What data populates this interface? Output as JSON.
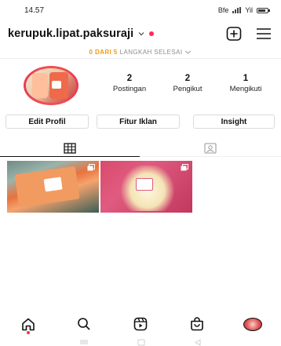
{
  "status_bar": {
    "time": "14.57",
    "network": "Bfe",
    "signal_text": "Yil"
  },
  "header": {
    "username": "kerupuk.lipat.paksuraji",
    "icons": [
      "chevron-down-icon",
      "notification-dot",
      "add-post-icon",
      "menu-icon"
    ]
  },
  "steps": {
    "highlight": "0 DARI 5",
    "rest": "LANGKAH SELESAI"
  },
  "profile": {
    "stats": [
      {
        "value": "2",
        "label": "Postingan"
      },
      {
        "value": "2",
        "label": "Pengikut"
      },
      {
        "value": "1",
        "label": "Mengikuti"
      }
    ]
  },
  "buttons": {
    "edit_profile": "Edit Profil",
    "ads_tools": "Fitur Iklan",
    "insight": "Insight"
  },
  "tabs": [
    "grid-icon",
    "tagged-icon"
  ],
  "bottom_nav": [
    "home-icon",
    "search-icon",
    "reels-icon",
    "shop-icon",
    "profile-avatar"
  ],
  "colors": {
    "accent": "#ff2d55",
    "steps_highlight": "#f09a1a",
    "border": "#dbdbdb"
  }
}
